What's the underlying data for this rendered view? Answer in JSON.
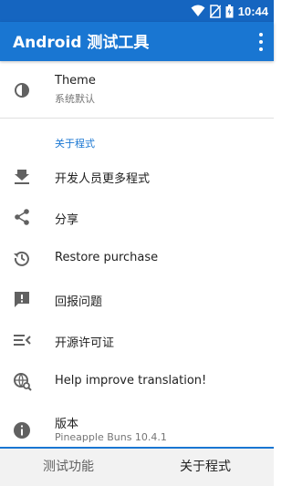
{
  "status_bar": {
    "time": "10:44"
  },
  "app_bar": {
    "title": "Android 测试工具"
  },
  "settings": {
    "theme": {
      "title": "Theme",
      "value": "系统默认"
    },
    "about_header": "关于程式",
    "items": [
      {
        "label": "开发人员更多程式",
        "icon": "download-icon"
      },
      {
        "label": "分享",
        "icon": "share-icon"
      },
      {
        "label": "Restore purchase",
        "icon": "restore-icon"
      },
      {
        "label": "回报问题",
        "icon": "feedback-icon"
      },
      {
        "label": "开源许可证",
        "icon": "license-icon"
      },
      {
        "label": "Help improve translation!",
        "icon": "translate-search-icon"
      }
    ],
    "version": {
      "title": "版本",
      "value": "Pineapple Buns 10.4.1"
    }
  },
  "tabs": [
    {
      "label": "测试功能",
      "active": false
    },
    {
      "label": "关于程式",
      "active": true
    }
  ],
  "colors": {
    "primary": "#1976d2",
    "status_bar": "#1565c0",
    "icon": "#616161"
  }
}
